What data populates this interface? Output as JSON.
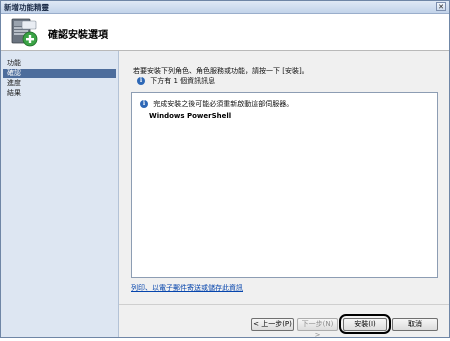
{
  "window": {
    "title": "新增功能精靈",
    "close_glyph": "✕"
  },
  "header": {
    "title": "確認安裝選項"
  },
  "sidebar": {
    "items": [
      {
        "label": "功能",
        "active": false
      },
      {
        "label": "確認",
        "active": true
      },
      {
        "label": "進度",
        "active": false
      },
      {
        "label": "結果",
        "active": false
      }
    ]
  },
  "main": {
    "instruction": "若要安裝下列角色、角色服務或功能，請按一下 [安裝]。",
    "info_message": "下方有 1 個資訊訊息",
    "list": {
      "warning": "完成安裝之後可能必須重新啟動這部伺服器。",
      "feature": "Windows PowerShell"
    },
    "link": "列印、以電子郵件寄送或儲存此資訊"
  },
  "buttons": {
    "previous": "< 上一步(P)",
    "next": "下一步(N) >",
    "install": "安裝(I)",
    "cancel": "取消"
  },
  "colors": {
    "sidebar_bg": "#dde6f2",
    "active_item": "#4d6d9c",
    "info_icon": "#2e68b6",
    "link": "#0645ad"
  },
  "icons": {
    "info": "information-icon",
    "header": "server-add-feature-icon"
  }
}
